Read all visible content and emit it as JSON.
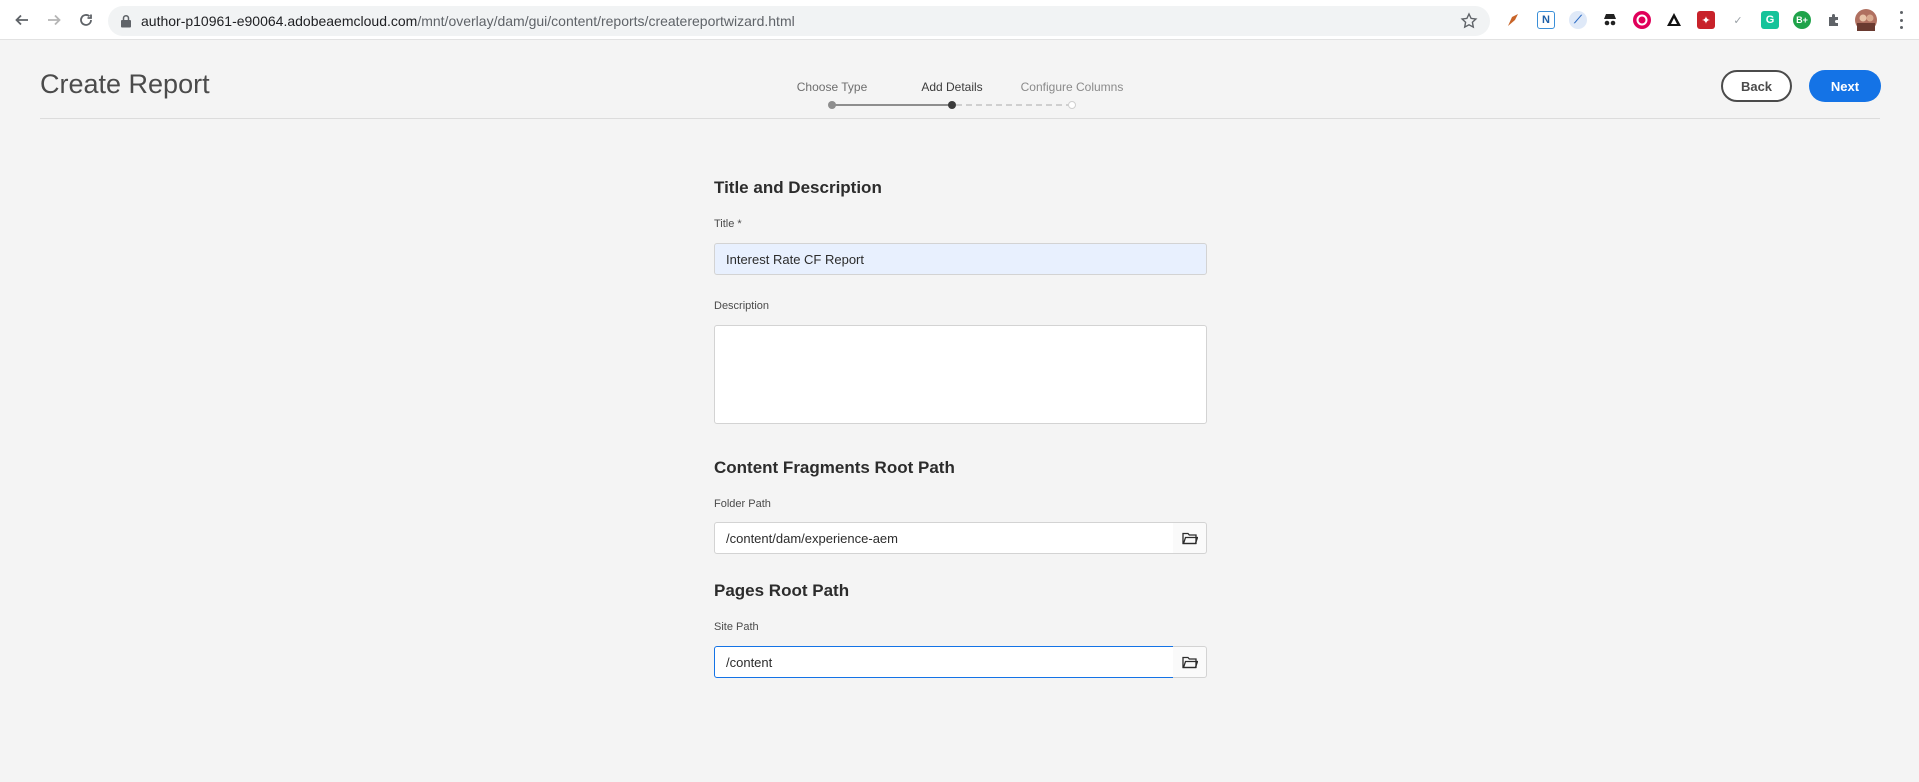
{
  "browser": {
    "url_host": "author-p10961-e90064.adobeaemcloud.com",
    "url_path": "/mnt/overlay/dam/gui/content/reports/createreportwizard.html",
    "extension_icons": [
      "pen-tool-icon",
      "notion-icon",
      "compass-icon",
      "spy-icon",
      "chromecast-icon",
      "adobe-icon",
      "red-extension-icon",
      "bird-icon",
      "grammarly-icon",
      "b-plus-icon",
      "puzzle-icon",
      "profile-avatar"
    ]
  },
  "header": {
    "title": "Create Report",
    "steps": [
      {
        "label": "Choose Type",
        "state": "done"
      },
      {
        "label": "Add Details",
        "state": "current"
      },
      {
        "label": "Configure Columns",
        "state": "todo"
      }
    ],
    "back_label": "Back",
    "next_label": "Next"
  },
  "form": {
    "title_section": {
      "heading": "Title and Description",
      "title_label": "Title *",
      "title_value": "Interest Rate CF Report",
      "description_label": "Description",
      "description_value": ""
    },
    "cf_section": {
      "heading": "Content Fragments Root Path",
      "folder_label": "Folder Path",
      "folder_value": "/content/dam/experience-aem"
    },
    "pages_section": {
      "heading": "Pages Root Path",
      "site_label": "Site Path",
      "site_value": "/content"
    }
  },
  "colors": {
    "accent": "#1473e6",
    "background": "#f4f4f4",
    "autofill": "#e8f0fe"
  }
}
